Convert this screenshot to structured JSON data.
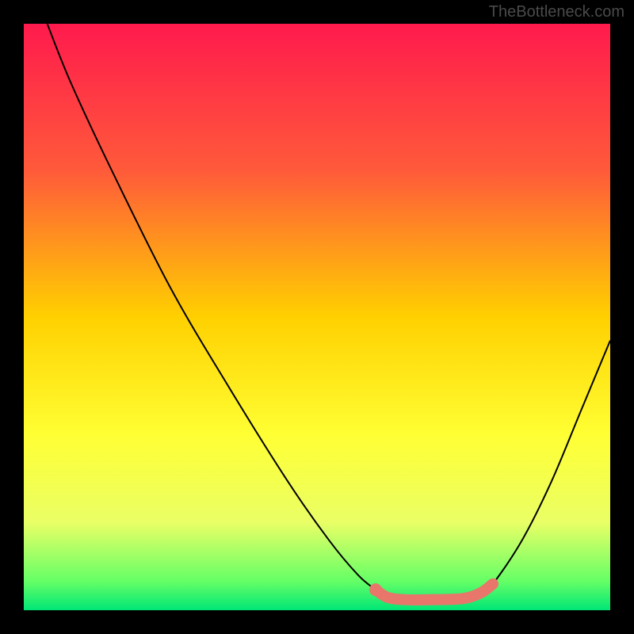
{
  "watermark": "TheBottleneck.com",
  "chart_data": {
    "type": "line",
    "title": "",
    "xlabel": "",
    "ylabel": "",
    "xlim": [
      0,
      100
    ],
    "ylim": [
      0,
      100
    ],
    "gradient_stops": [
      {
        "offset": 0,
        "color": "#ff1a4d"
      },
      {
        "offset": 25,
        "color": "#ff5a3a"
      },
      {
        "offset": 50,
        "color": "#ffd000"
      },
      {
        "offset": 70,
        "color": "#ffff33"
      },
      {
        "offset": 85,
        "color": "#eaff66"
      },
      {
        "offset": 95,
        "color": "#66ff66"
      },
      {
        "offset": 100,
        "color": "#00e676"
      }
    ],
    "series": [
      {
        "name": "bottleneck-curve",
        "color": "#000000",
        "points": [
          {
            "x": 4,
            "y": 100
          },
          {
            "x": 8,
            "y": 90
          },
          {
            "x": 15,
            "y": 75
          },
          {
            "x": 25,
            "y": 55
          },
          {
            "x": 35,
            "y": 38
          },
          {
            "x": 45,
            "y": 22
          },
          {
            "x": 52,
            "y": 12
          },
          {
            "x": 57,
            "y": 6
          },
          {
            "x": 60,
            "y": 3.5
          },
          {
            "x": 62,
            "y": 2.2
          },
          {
            "x": 65,
            "y": 1.8
          },
          {
            "x": 70,
            "y": 1.8
          },
          {
            "x": 75,
            "y": 2.0
          },
          {
            "x": 78,
            "y": 3.0
          },
          {
            "x": 80,
            "y": 4.5
          },
          {
            "x": 85,
            "y": 12
          },
          {
            "x": 90,
            "y": 22
          },
          {
            "x": 95,
            "y": 34
          },
          {
            "x": 100,
            "y": 46
          }
        ]
      },
      {
        "name": "highlight-segment",
        "color": "#e8766b",
        "stroke_width": 14,
        "points": [
          {
            "x": 60,
            "y": 3.5
          },
          {
            "x": 62,
            "y": 2.2
          },
          {
            "x": 65,
            "y": 1.8
          },
          {
            "x": 70,
            "y": 1.8
          },
          {
            "x": 75,
            "y": 2.0
          },
          {
            "x": 78,
            "y": 3.0
          },
          {
            "x": 80,
            "y": 4.5
          }
        ]
      }
    ],
    "highlight_dot": {
      "x": 60,
      "y": 3.5,
      "r": 8,
      "color": "#e8766b"
    }
  }
}
